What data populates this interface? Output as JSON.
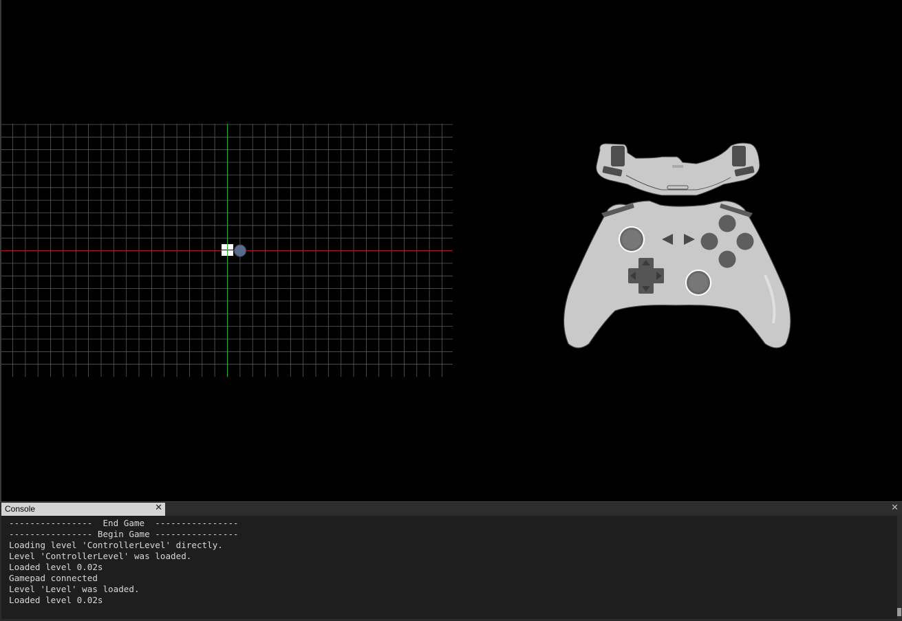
{
  "viewport": {
    "grid": {
      "line_color": "#5c5c5c",
      "x_axis_color": "#b3142d",
      "y_axis_color": "#22b32c"
    },
    "origin_marker": {
      "icon": "windows-logo-icon",
      "color": "#ffffff"
    },
    "player_dot": {
      "icon": "player-dot-icon",
      "color": "#5a6a88"
    },
    "controller": {
      "icon": "gamepad-icon",
      "body_color": "#c9c9c9",
      "button_color": "#595959",
      "outline_color": "#3d3d3d"
    }
  },
  "console": {
    "tab_label": "Console",
    "close_icon": "close-icon",
    "panel_close_icon": "close-icon",
    "lines": [
      "----------------  End Game  ----------------",
      "---------------- Begin Game ----------------",
      "Loading level 'ControllerLevel' directly.",
      "Level 'ControllerLevel' was loaded.",
      "Loaded level 0.02s",
      "Gamepad connected",
      "Level 'Level' was loaded.",
      "Loaded level 0.02s"
    ]
  }
}
